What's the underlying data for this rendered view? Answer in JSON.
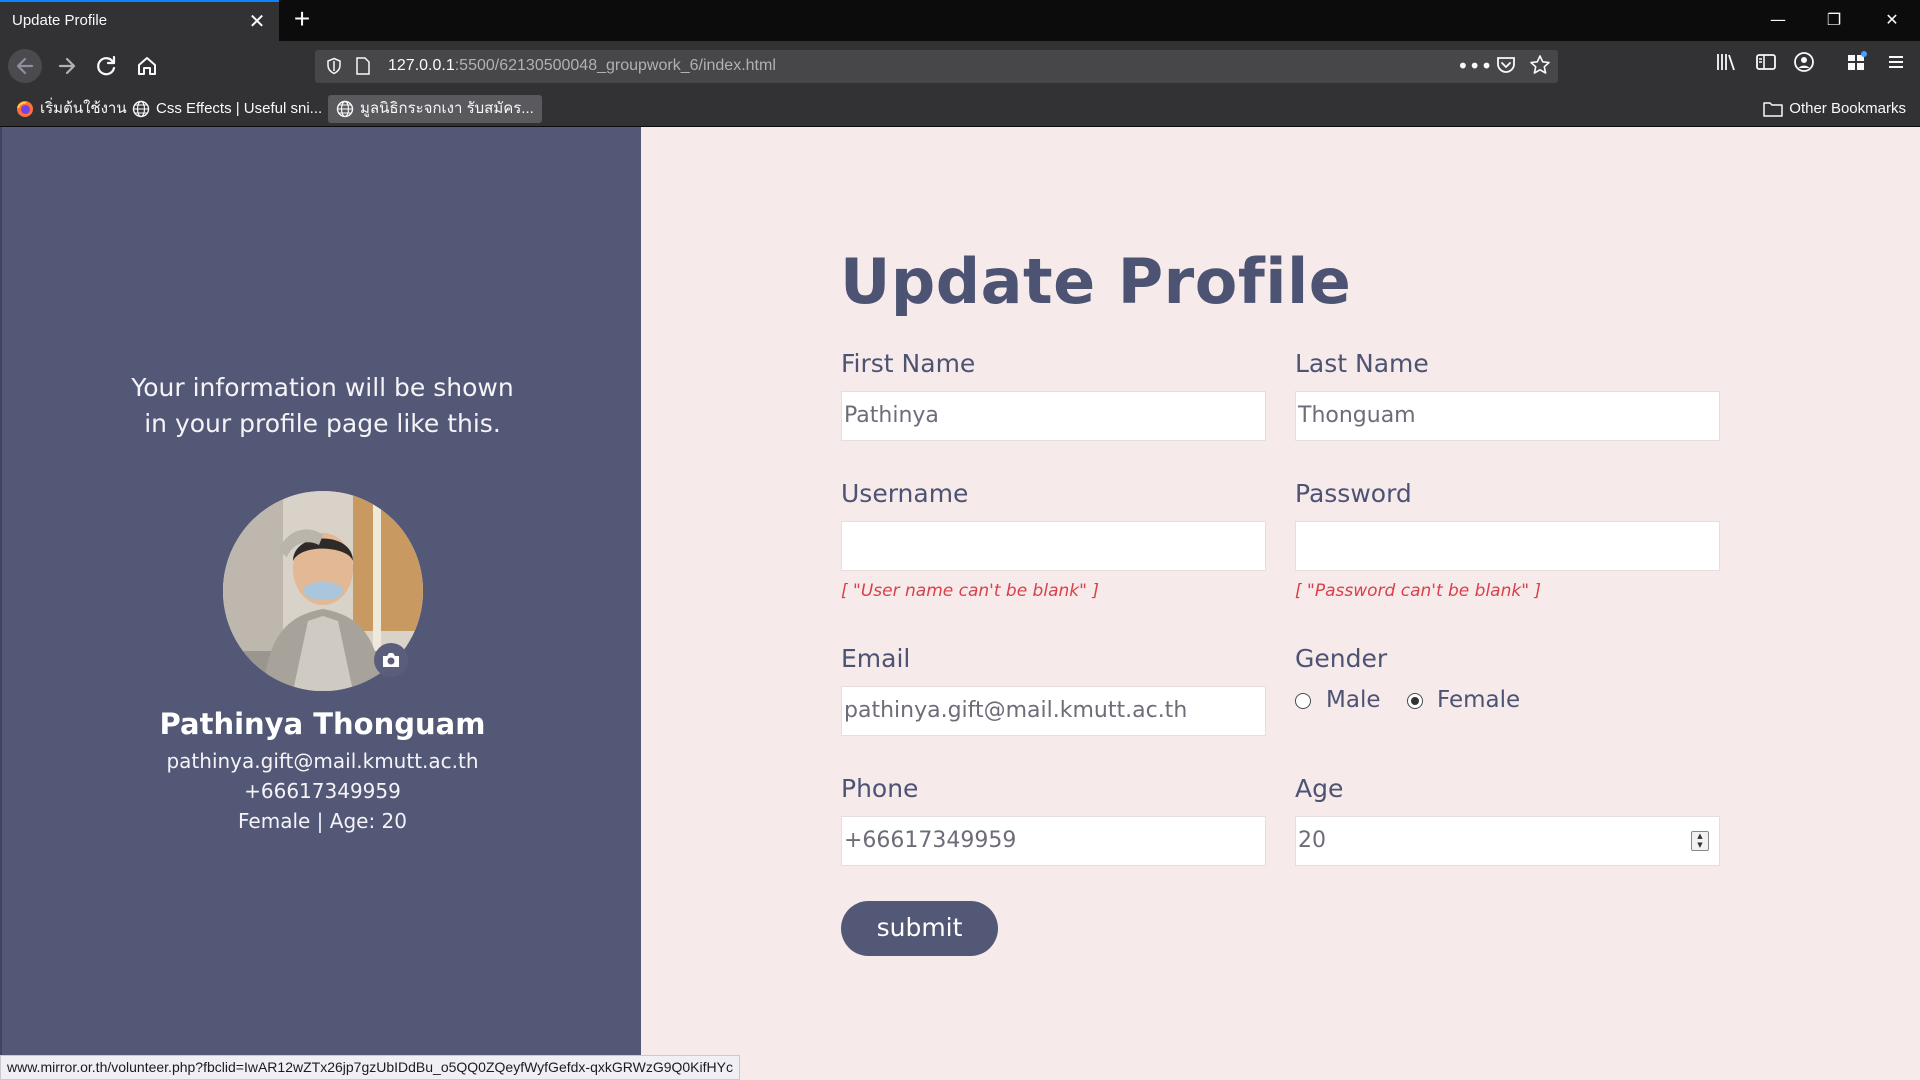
{
  "browser": {
    "tab_title": "Update Profile",
    "tab_close": "✕",
    "new_tab": "+",
    "window_controls": {
      "minimize": "—",
      "restore": "❐",
      "close": "✕"
    },
    "url_host": "127.0.0.1",
    "url_path": ":5500/62130500048_groupwork_6/index.html",
    "page_actions": "•••",
    "bookmarks": [
      {
        "label": "เริ่มต้นใช้งาน",
        "icon": "firefox-icon"
      },
      {
        "label": "Css Effects | Useful sni...",
        "icon": "globe-icon"
      },
      {
        "label": "มูลนิธิกระจกเงา รับสมัคร...",
        "icon": "globe-icon"
      }
    ],
    "other_bookmarks": "Other Bookmarks",
    "status_url": "www.mirror.or.th/volunteer.php?fbclid=IwAR12wZTx26jp7gzUbIDdBu_o5QQ0ZQeyfWyfGefdx-qxkGRWzG9Q0KifHYc"
  },
  "preview": {
    "intro_line1": "Your information will be shown",
    "intro_line2": "in your profile page like this.",
    "name": "Pathinya Thonguam",
    "email": "pathinya.gift@mail.kmutt.ac.th",
    "phone": "+66617349959",
    "gender_age": "Female | Age: 20"
  },
  "form": {
    "title": "Update Profile",
    "first_name": {
      "label": "First Name",
      "value": "Pathinya"
    },
    "last_name": {
      "label": "Last Name",
      "value": "Thonguam"
    },
    "username": {
      "label": "Username",
      "value": "",
      "error": "[ \"User name can't be blank\" ]"
    },
    "password": {
      "label": "Password",
      "value": "",
      "error": "[ \"Password can't be blank\" ]"
    },
    "email": {
      "label": "Email",
      "value": "pathinya.gift@mail.kmutt.ac.th"
    },
    "gender": {
      "label": "Gender",
      "options": [
        "Male",
        "Female"
      ],
      "selected": "Female"
    },
    "phone": {
      "label": "Phone",
      "value": "+66617349959"
    },
    "age": {
      "label": "Age",
      "value": "20"
    },
    "submit_label": "submit"
  }
}
